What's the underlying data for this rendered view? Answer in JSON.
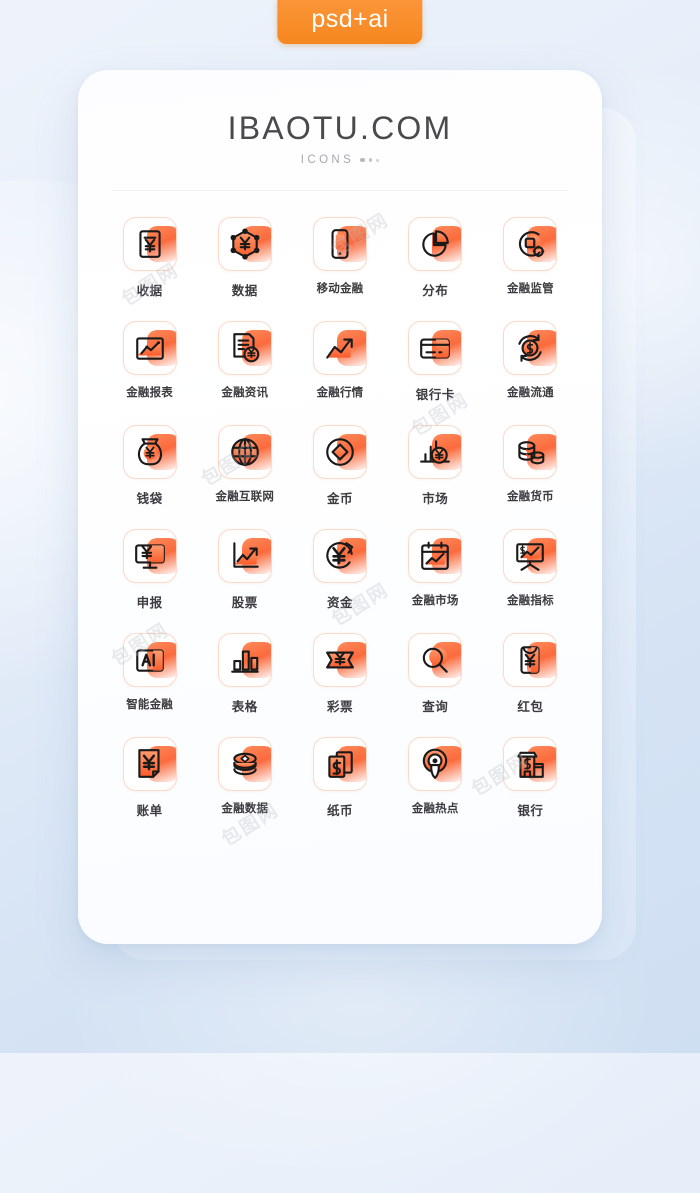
{
  "badge": {
    "label": "psd+ai",
    "color": "#f6871f"
  },
  "card": {
    "brand": "IBAOTU.COM",
    "subtitle": "ICONS"
  },
  "theme": {
    "accent_orange": "#fb6a3c",
    "accent_orange_light": "#ff8a5c",
    "tile_border": "#fcd9c8",
    "label_color": "#3c3c40",
    "background_blue": "#d5e3f4"
  },
  "watermark": {
    "text": "包图网"
  },
  "icons": [
    {
      "id": "shouju",
      "label": "收据",
      "glyph": "receipt-yen-icon"
    },
    {
      "id": "shuju",
      "label": "数据",
      "glyph": "hexagon-yen-icon"
    },
    {
      "id": "yidong-jinrong",
      "label": "移动金融",
      "glyph": "mobile-phone-icon"
    },
    {
      "id": "fenbu",
      "label": "分布",
      "glyph": "pie-chart-icon"
    },
    {
      "id": "jinrong-jianguan",
      "label": "金融监管",
      "glyph": "circle-gear-icon"
    },
    {
      "id": "jinrong-baobiao",
      "label": "金融报表",
      "glyph": "chart-frame-icon"
    },
    {
      "id": "jinrong-zixun",
      "label": "金融资讯",
      "glyph": "document-yen-icon"
    },
    {
      "id": "jinrong-hangqing",
      "label": "金融行情",
      "glyph": "trend-arrow-icon"
    },
    {
      "id": "yinhangka",
      "label": "银行卡",
      "glyph": "credit-card-icon"
    },
    {
      "id": "jinrong-liutong",
      "label": "金融流通",
      "glyph": "coin-refresh-icon"
    },
    {
      "id": "qiandai",
      "label": "钱袋",
      "glyph": "money-bag-icon"
    },
    {
      "id": "jinrong-hulianwang",
      "label": "金融互联网",
      "glyph": "globe-icon"
    },
    {
      "id": "jinbi",
      "label": "金币",
      "glyph": "gold-coin-icon"
    },
    {
      "id": "shichang",
      "label": "市场",
      "glyph": "market-bars-yen-icon"
    },
    {
      "id": "jinrong-huobi",
      "label": "金融货币",
      "glyph": "coin-stack-icon"
    },
    {
      "id": "shenbao",
      "label": "申报",
      "glyph": "monitor-yen-icon"
    },
    {
      "id": "gupiao",
      "label": "股票",
      "glyph": "stock-chart-icon"
    },
    {
      "id": "zijin",
      "label": "资金",
      "glyph": "yen-refresh-icon"
    },
    {
      "id": "jinrong-shichang",
      "label": "金融市场",
      "glyph": "calendar-chart-icon"
    },
    {
      "id": "jinrong-zhibiao",
      "label": "金融指标",
      "glyph": "presentation-board-icon"
    },
    {
      "id": "zhineng-jinrong",
      "label": "智能金融",
      "glyph": "ai-chip-icon"
    },
    {
      "id": "biaoge",
      "label": "表格",
      "glyph": "bar-chart-icon"
    },
    {
      "id": "caipiao",
      "label": "彩票",
      "glyph": "ticket-yen-icon"
    },
    {
      "id": "chaxun",
      "label": "查询",
      "glyph": "magnifier-icon"
    },
    {
      "id": "hongbao",
      "label": "红包",
      "glyph": "red-envelope-icon"
    },
    {
      "id": "zhangdan",
      "label": "账单",
      "glyph": "bill-yen-icon"
    },
    {
      "id": "jinrong-shuju",
      "label": "金融数据",
      "glyph": "ingot-stack-icon"
    },
    {
      "id": "zhibi",
      "label": "纸币",
      "glyph": "banknote-dollar-icon"
    },
    {
      "id": "jinrong-redian",
      "label": "金融热点",
      "glyph": "hotspot-pin-icon"
    },
    {
      "id": "yinhang",
      "label": "银行",
      "glyph": "bank-building-icon"
    }
  ]
}
